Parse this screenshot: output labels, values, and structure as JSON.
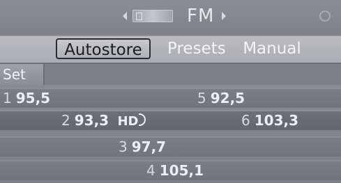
{
  "header": {
    "band_label": "FM",
    "left_arrow_icon": "arrow-left-icon",
    "right_arrow_icon": "arrow-right-icon",
    "band_icon": "radio-band-icon",
    "knob_icon": "controller-icon"
  },
  "tabs": [
    {
      "label": "Autostore",
      "active": true
    },
    {
      "label": "Presets",
      "active": false
    },
    {
      "label": "Manual",
      "active": false
    }
  ],
  "set_label": "Set",
  "stations": [
    {
      "num": "1",
      "freq": "95,5"
    },
    {
      "num": "5",
      "freq": "92,5"
    },
    {
      "num": "2",
      "freq": "93,3",
      "hd": "HD"
    },
    {
      "num": "6",
      "freq": "103,3"
    },
    {
      "num": "3",
      "freq": "97,7"
    },
    {
      "num": "4",
      "freq": "105,1"
    }
  ]
}
